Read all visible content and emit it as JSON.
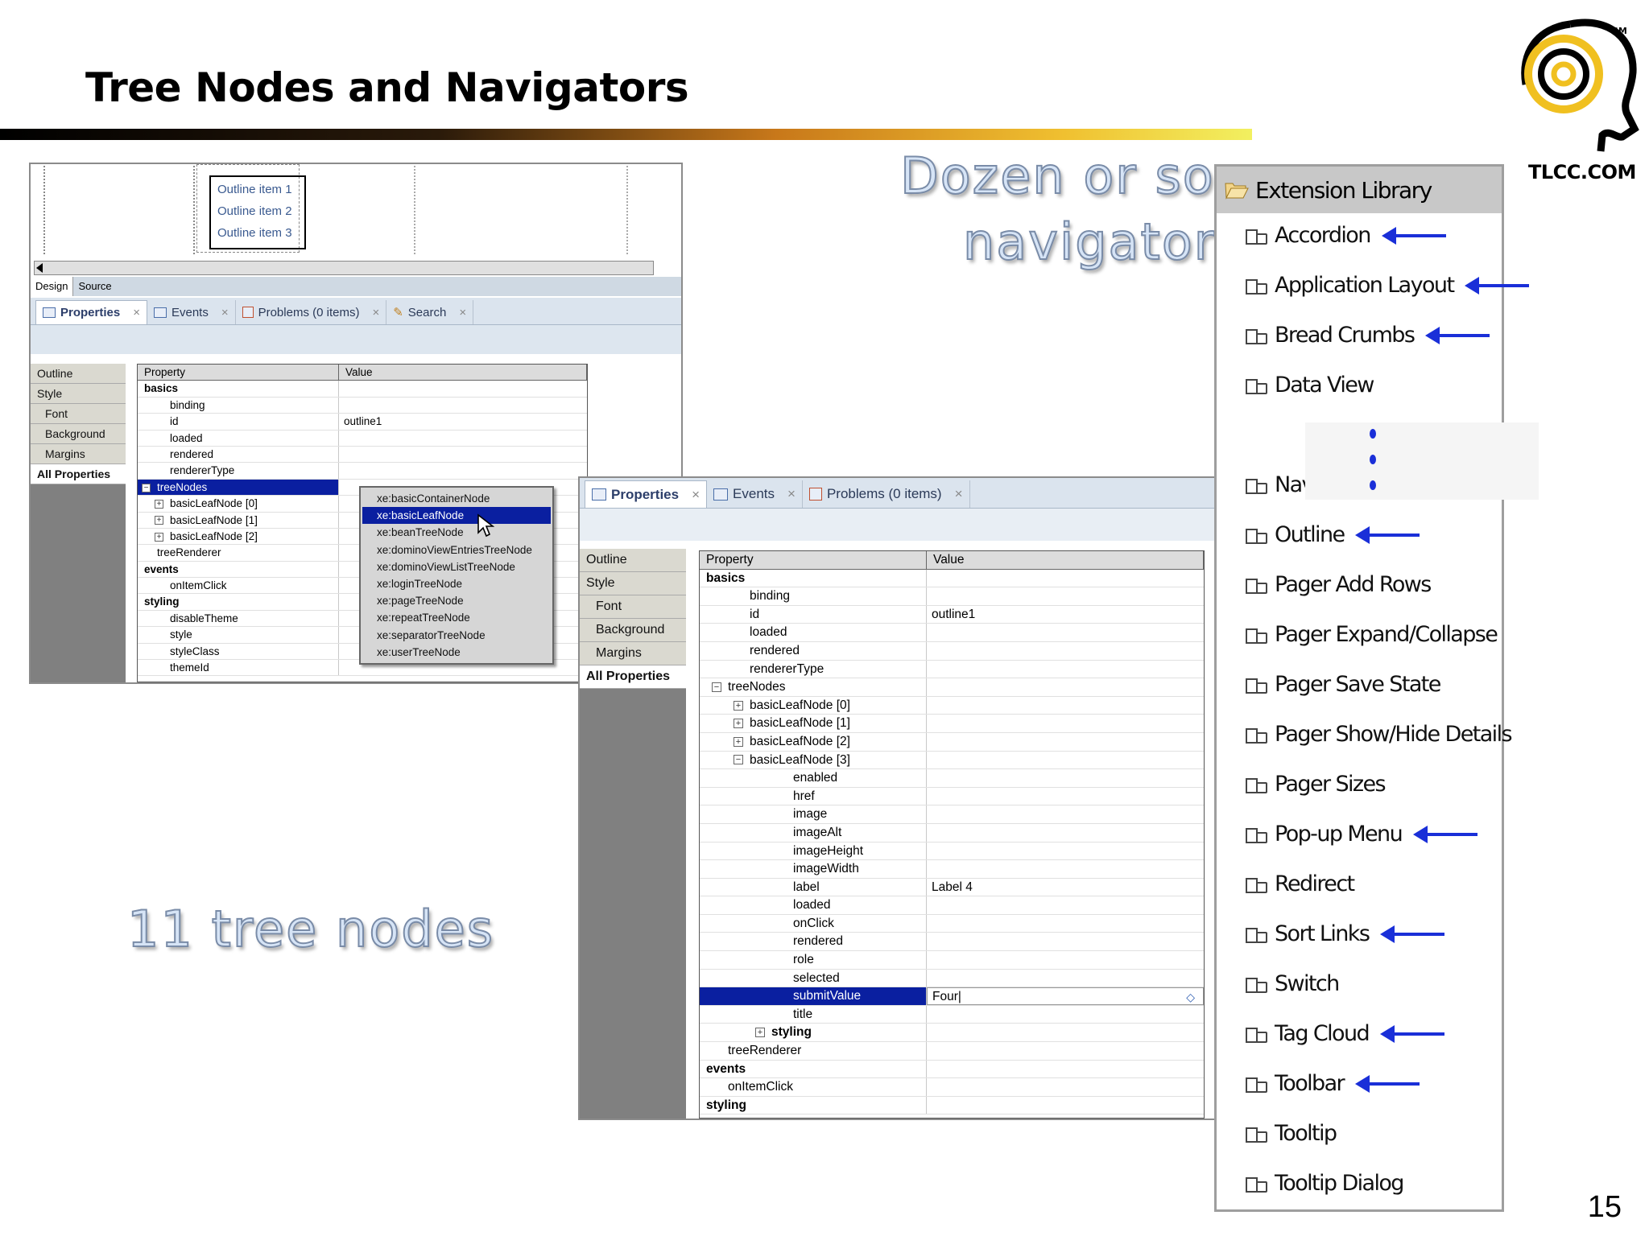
{
  "slide": {
    "title": "Tree Nodes and Navigators",
    "page_number": "15",
    "callouts": {
      "navigators_line1": "Dozen or so",
      "navigators_line2": "navigators",
      "tree_nodes": "11 tree nodes"
    },
    "logo": {
      "text": "TLCC.COM",
      "mark": "SM"
    }
  },
  "colors": {
    "selection": "#0a1fa0",
    "arrow": "#1a2fd8",
    "menu_highlight": "#0a1fa0"
  },
  "designer": {
    "outline_items": [
      "Outline item 1",
      "Outline item 2",
      "Outline item 3"
    ],
    "bottom_tabs": [
      "Design",
      "Source"
    ]
  },
  "panel1": {
    "tabs": [
      {
        "label": "Properties",
        "icon": "properties-icon"
      },
      {
        "label": "Events",
        "icon": "events-icon"
      },
      {
        "label": "Problems (0 items)",
        "icon": "problems-icon"
      },
      {
        "label": "Search",
        "icon": "search-icon"
      }
    ],
    "categories": [
      "Outline",
      "Style",
      "Font",
      "Background",
      "Margins",
      "All Properties"
    ],
    "headers": {
      "property": "Property",
      "value": "Value"
    },
    "rows": [
      {
        "name": "basics",
        "value": "",
        "indent": 0,
        "twisty": "minus",
        "bold": true
      },
      {
        "name": "binding",
        "value": "",
        "indent": 2
      },
      {
        "name": "id",
        "value": "outline1",
        "indent": 2
      },
      {
        "name": "loaded",
        "value": "",
        "indent": 2
      },
      {
        "name": "rendered",
        "value": "",
        "indent": 2
      },
      {
        "name": "rendererType",
        "value": "",
        "indent": 2
      },
      {
        "name": "treeNodes",
        "value": "",
        "indent": 1,
        "twisty": "minus",
        "highlight": true
      },
      {
        "name": "basicLeafNode [0]",
        "value": "",
        "indent": 2,
        "twisty": "plus"
      },
      {
        "name": "basicLeafNode [1]",
        "value": "",
        "indent": 2,
        "twisty": "plus"
      },
      {
        "name": "basicLeafNode [2]",
        "value": "",
        "indent": 2,
        "twisty": "plus"
      },
      {
        "name": "treeRenderer",
        "value": "",
        "indent": 1
      },
      {
        "name": "events",
        "value": "",
        "indent": 0,
        "twisty": "minus",
        "bold": true
      },
      {
        "name": "onItemClick",
        "value": "",
        "indent": 2
      },
      {
        "name": "styling",
        "value": "",
        "indent": 0,
        "twisty": "minus",
        "bold": true
      },
      {
        "name": "disableTheme",
        "value": "",
        "indent": 2
      },
      {
        "name": "style",
        "value": "",
        "indent": 2
      },
      {
        "name": "styleClass",
        "value": "",
        "indent": 2
      },
      {
        "name": "themeId",
        "value": "",
        "indent": 2
      }
    ],
    "popup_menu": [
      "xe:basicContainerNode",
      "xe:basicLeafNode",
      "xe:beanTreeNode",
      "xe:dominoViewEntriesTreeNode",
      "xe:dominoViewListTreeNode",
      "xe:loginTreeNode",
      "xe:pageTreeNode",
      "xe:repeatTreeNode",
      "xe:separatorTreeNode",
      "xe:userTreeNode"
    ],
    "popup_selected_index": 1
  },
  "panel2": {
    "tabs": [
      {
        "label": "Properties",
        "icon": "properties-icon"
      },
      {
        "label": "Events",
        "icon": "events-icon"
      },
      {
        "label": "Problems (0 items)",
        "icon": "problems-icon"
      }
    ],
    "categories": [
      "Outline",
      "Style",
      "Font",
      "Background",
      "Margins",
      "All Properties"
    ],
    "headers": {
      "property": "Property",
      "value": "Value"
    },
    "rows": [
      {
        "name": "basics",
        "value": "",
        "indent": 0,
        "twisty": "minus",
        "bold": true
      },
      {
        "name": "binding",
        "value": "",
        "indent": 2
      },
      {
        "name": "id",
        "value": "outline1",
        "indent": 2
      },
      {
        "name": "loaded",
        "value": "",
        "indent": 2
      },
      {
        "name": "rendered",
        "value": "",
        "indent": 2
      },
      {
        "name": "rendererType",
        "value": "",
        "indent": 2
      },
      {
        "name": "treeNodes",
        "value": "",
        "indent": 1,
        "twisty": "minus"
      },
      {
        "name": "basicLeafNode [0]",
        "value": "",
        "indent": 2,
        "twisty": "plus"
      },
      {
        "name": "basicLeafNode [1]",
        "value": "",
        "indent": 2,
        "twisty": "plus"
      },
      {
        "name": "basicLeafNode [2]",
        "value": "",
        "indent": 2,
        "twisty": "plus"
      },
      {
        "name": "basicLeafNode [3]",
        "value": "",
        "indent": 2,
        "twisty": "minus"
      },
      {
        "name": "enabled",
        "value": "",
        "indent": 4
      },
      {
        "name": "href",
        "value": "",
        "indent": 4
      },
      {
        "name": "image",
        "value": "",
        "indent": 4
      },
      {
        "name": "imageAlt",
        "value": "",
        "indent": 4
      },
      {
        "name": "imageHeight",
        "value": "",
        "indent": 4
      },
      {
        "name": "imageWidth",
        "value": "",
        "indent": 4
      },
      {
        "name": "label",
        "value": "Label 4",
        "indent": 4
      },
      {
        "name": "loaded",
        "value": "",
        "indent": 4
      },
      {
        "name": "onClick",
        "value": "",
        "indent": 4
      },
      {
        "name": "rendered",
        "value": "",
        "indent": 4
      },
      {
        "name": "role",
        "value": "",
        "indent": 4
      },
      {
        "name": "selected",
        "value": "",
        "indent": 4
      },
      {
        "name": "submitValue",
        "value": "Four",
        "indent": 4,
        "highlight": true,
        "editing": true
      },
      {
        "name": "title",
        "value": "",
        "indent": 4
      },
      {
        "name": "styling",
        "value": "",
        "indent": 3,
        "twisty": "plus",
        "bold": true
      },
      {
        "name": "treeRenderer",
        "value": "",
        "indent": 1
      },
      {
        "name": "events",
        "value": "",
        "indent": 0,
        "twisty": "minus",
        "bold": true
      },
      {
        "name": "onItemClick",
        "value": "",
        "indent": 1
      },
      {
        "name": "styling",
        "value": "",
        "indent": 0,
        "twisty": "plus",
        "bold": true
      }
    ]
  },
  "extension_library": {
    "title": "Extension Library",
    "items": [
      {
        "label": "Accordion",
        "arrow": true
      },
      {
        "label": "Application Layout",
        "arrow": true
      },
      {
        "label": "Bread Crumbs",
        "arrow": true
      },
      {
        "label": "Data View",
        "arrow": false
      },
      {
        "label": "Navigator",
        "arrow": true
      },
      {
        "label": "Outline",
        "arrow": true
      },
      {
        "label": "Pager Add Rows",
        "arrow": false
      },
      {
        "label": "Pager Expand/Collapse",
        "arrow": false
      },
      {
        "label": "Pager Save State",
        "arrow": false
      },
      {
        "label": "Pager Show/Hide Details",
        "arrow": false
      },
      {
        "label": "Pager Sizes",
        "arrow": false
      },
      {
        "label": "Pop-up Menu",
        "arrow": true
      },
      {
        "label": "Redirect",
        "arrow": false
      },
      {
        "label": "Sort Links",
        "arrow": true
      },
      {
        "label": "Switch",
        "arrow": false
      },
      {
        "label": "Tag Cloud",
        "arrow": true
      },
      {
        "label": "Toolbar",
        "arrow": true
      },
      {
        "label": "Tooltip",
        "arrow": false
      },
      {
        "label": "Tooltip Dialog",
        "arrow": false
      }
    ]
  }
}
